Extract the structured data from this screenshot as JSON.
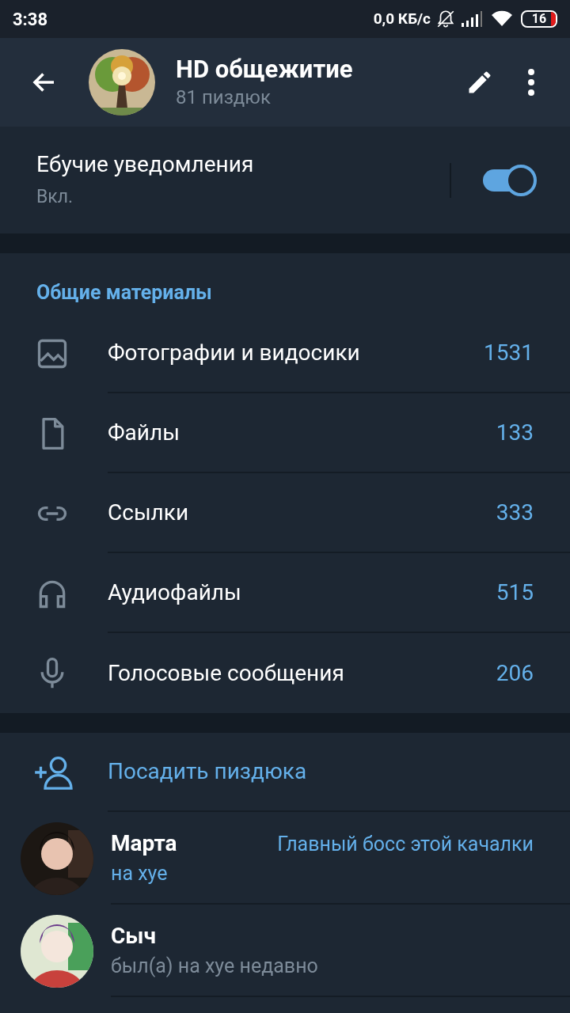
{
  "status_bar": {
    "time": "3:38",
    "speed": "0,0 КБ/с",
    "battery": "16"
  },
  "header": {
    "title": "HD общежитие",
    "subtitle": "81 пиздюк"
  },
  "notifications": {
    "label": "Ебучие уведомления",
    "value": "Вкл.",
    "on": true
  },
  "shared_media": {
    "heading": "Общие материалы",
    "items": [
      {
        "label": "Фотографии и видосики",
        "count": "1531"
      },
      {
        "kind": "file",
        "label": "Файлы",
        "count": "133"
      },
      {
        "kind": "link",
        "label": "Ссылки",
        "count": "333"
      },
      {
        "kind": "audio",
        "label": "Аудиофайлы",
        "count": "515"
      },
      {
        "kind": "voice",
        "label": "Голосовые сообщения",
        "count": "206"
      }
    ]
  },
  "add_member": {
    "label": "Посадить пиздюка"
  },
  "members": [
    {
      "name": "Марта",
      "status": "на хуе",
      "online": true,
      "role": "Главный босс этой качалки"
    },
    {
      "name": "Сыч",
      "status": "был(а) на хуе недавно",
      "online": false
    }
  ]
}
